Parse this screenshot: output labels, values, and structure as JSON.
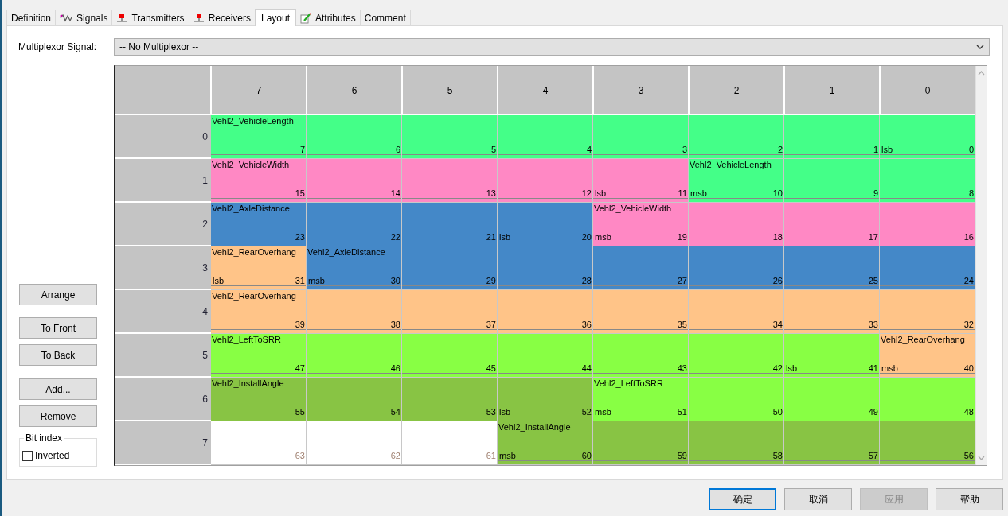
{
  "tabs": [
    {
      "label": "Definition",
      "selected": false
    },
    {
      "label": "Signals",
      "selected": false
    },
    {
      "label": "Transmitters",
      "selected": false
    },
    {
      "label": "Receivers",
      "selected": false
    },
    {
      "label": "Layout",
      "selected": true
    },
    {
      "label": "Attributes",
      "selected": false
    },
    {
      "label": "Comment",
      "selected": false
    }
  ],
  "multiplexor": {
    "label": "Multiplexor Signal:",
    "value": "-- No Multiplexor --"
  },
  "side_buttons": [
    {
      "label": "Arrange"
    },
    {
      "label": "To Front"
    },
    {
      "label": "To Back"
    },
    {
      "label": "Add..."
    },
    {
      "label": "Remove"
    }
  ],
  "bit_index": {
    "title": "Bit index",
    "label": "Inverted",
    "checked": false
  },
  "grid": {
    "columns": [
      "7",
      "6",
      "5",
      "4",
      "3",
      "2",
      "1",
      "0"
    ],
    "rows": [
      {
        "label": "0",
        "cells": [
          {
            "kind": "signal",
            "bit": "7",
            "color": "#44ff88",
            "signal": "Vehl2_VehicleLength"
          },
          {
            "kind": "signal",
            "bit": "6",
            "color": "#44ff88"
          },
          {
            "kind": "signal",
            "bit": "5",
            "color": "#44ff88"
          },
          {
            "kind": "signal",
            "bit": "4",
            "color": "#44ff88"
          },
          {
            "kind": "signal",
            "bit": "3",
            "color": "#44ff88"
          },
          {
            "kind": "signal",
            "bit": "2",
            "color": "#44ff88"
          },
          {
            "kind": "signal",
            "bit": "1",
            "color": "#44ff88"
          },
          {
            "kind": "signal",
            "bit": "0",
            "color": "#44ff88",
            "tag": "lsb"
          }
        ]
      },
      {
        "label": "1",
        "cells": [
          {
            "kind": "signal",
            "bit": "15",
            "color": "#ff88c4",
            "signal": "Vehl2_VehicleWidth"
          },
          {
            "kind": "signal",
            "bit": "14",
            "color": "#ff88c4"
          },
          {
            "kind": "signal",
            "bit": "13",
            "color": "#ff88c4"
          },
          {
            "kind": "signal",
            "bit": "12",
            "color": "#ff88c4"
          },
          {
            "kind": "signal",
            "bit": "11",
            "color": "#ff88c4",
            "tag": "lsb"
          },
          {
            "kind": "signal",
            "bit": "10",
            "color": "#44ff88",
            "signal": "Vehl2_VehicleLength",
            "tag": "msb"
          },
          {
            "kind": "signal",
            "bit": "9",
            "color": "#44ff88"
          },
          {
            "kind": "signal",
            "bit": "8",
            "color": "#44ff88"
          }
        ]
      },
      {
        "label": "2",
        "cells": [
          {
            "kind": "signal",
            "bit": "23",
            "color": "#4488c8",
            "signal": "Vehl2_AxleDistance"
          },
          {
            "kind": "signal",
            "bit": "22",
            "color": "#4488c8"
          },
          {
            "kind": "signal",
            "bit": "21",
            "color": "#4488c8"
          },
          {
            "kind": "signal",
            "bit": "20",
            "color": "#4488c8",
            "tag": "lsb"
          },
          {
            "kind": "signal",
            "bit": "19",
            "color": "#ff88c4",
            "signal": "Vehl2_VehicleWidth",
            "tag": "msb"
          },
          {
            "kind": "signal",
            "bit": "18",
            "color": "#ff88c4"
          },
          {
            "kind": "signal",
            "bit": "17",
            "color": "#ff88c4"
          },
          {
            "kind": "signal",
            "bit": "16",
            "color": "#ff88c4"
          }
        ]
      },
      {
        "label": "3",
        "cells": [
          {
            "kind": "signal",
            "bit": "31",
            "color": "#ffc488",
            "signal": "Vehl2_RearOverhang",
            "tag": "lsb"
          },
          {
            "kind": "signal",
            "bit": "30",
            "color": "#4488c8",
            "signal": "Vehl2_AxleDistance",
            "tag": "msb"
          },
          {
            "kind": "signal",
            "bit": "29",
            "color": "#4488c8"
          },
          {
            "kind": "signal",
            "bit": "28",
            "color": "#4488c8"
          },
          {
            "kind": "signal",
            "bit": "27",
            "color": "#4488c8"
          },
          {
            "kind": "signal",
            "bit": "26",
            "color": "#4488c8"
          },
          {
            "kind": "signal",
            "bit": "25",
            "color": "#4488c8"
          },
          {
            "kind": "signal",
            "bit": "24",
            "color": "#4488c8"
          }
        ]
      },
      {
        "label": "4",
        "cells": [
          {
            "kind": "signal",
            "bit": "39",
            "color": "#ffc488",
            "signal": "Vehl2_RearOverhang"
          },
          {
            "kind": "signal",
            "bit": "38",
            "color": "#ffc488"
          },
          {
            "kind": "signal",
            "bit": "37",
            "color": "#ffc488"
          },
          {
            "kind": "signal",
            "bit": "36",
            "color": "#ffc488"
          },
          {
            "kind": "signal",
            "bit": "35",
            "color": "#ffc488"
          },
          {
            "kind": "signal",
            "bit": "34",
            "color": "#ffc488"
          },
          {
            "kind": "signal",
            "bit": "33",
            "color": "#ffc488"
          },
          {
            "kind": "signal",
            "bit": "32",
            "color": "#ffc488"
          }
        ]
      },
      {
        "label": "5",
        "cells": [
          {
            "kind": "signal",
            "bit": "47",
            "color": "#88ff44",
            "signal": "Vehl2_LeftToSRR"
          },
          {
            "kind": "signal",
            "bit": "46",
            "color": "#88ff44"
          },
          {
            "kind": "signal",
            "bit": "45",
            "color": "#88ff44"
          },
          {
            "kind": "signal",
            "bit": "44",
            "color": "#88ff44"
          },
          {
            "kind": "signal",
            "bit": "43",
            "color": "#88ff44"
          },
          {
            "kind": "signal",
            "bit": "42",
            "color": "#88ff44"
          },
          {
            "kind": "signal",
            "bit": "41",
            "color": "#88ff44",
            "tag": "lsb"
          },
          {
            "kind": "signal",
            "bit": "40",
            "color": "#ffc488",
            "signal": "Vehl2_RearOverhang",
            "tag": "msb"
          }
        ]
      },
      {
        "label": "6",
        "cells": [
          {
            "kind": "signal",
            "bit": "55",
            "color": "#88c444",
            "signal": "Vehl2_InstallAngle"
          },
          {
            "kind": "signal",
            "bit": "54",
            "color": "#88c444"
          },
          {
            "kind": "signal",
            "bit": "53",
            "color": "#88c444"
          },
          {
            "kind": "signal",
            "bit": "52",
            "color": "#88c444",
            "tag": "lsb"
          },
          {
            "kind": "signal",
            "bit": "51",
            "color": "#88ff44",
            "signal": "Vehl2_LeftToSRR",
            "tag": "msb"
          },
          {
            "kind": "signal",
            "bit": "50",
            "color": "#88ff44"
          },
          {
            "kind": "signal",
            "bit": "49",
            "color": "#88ff44"
          },
          {
            "kind": "signal",
            "bit": "48",
            "color": "#88ff44"
          }
        ]
      },
      {
        "label": "7",
        "cells": [
          {
            "kind": "unused",
            "bit": "63"
          },
          {
            "kind": "unused",
            "bit": "62"
          },
          {
            "kind": "unused",
            "bit": "61"
          },
          {
            "kind": "signal",
            "bit": "60",
            "color": "#88c444",
            "signal": "Vehl2_InstallAngle",
            "tag": "msb"
          },
          {
            "kind": "signal",
            "bit": "59",
            "color": "#88c444"
          },
          {
            "kind": "signal",
            "bit": "58",
            "color": "#88c444"
          },
          {
            "kind": "signal",
            "bit": "57",
            "color": "#88c444"
          },
          {
            "kind": "signal",
            "bit": "56",
            "color": "#88c444"
          }
        ]
      }
    ]
  },
  "dialog_buttons": [
    {
      "label": "确定",
      "default": true,
      "disabled": false
    },
    {
      "label": "取消",
      "default": false,
      "disabled": false
    },
    {
      "label": "应用",
      "default": false,
      "disabled": true
    },
    {
      "label": "帮助",
      "default": false,
      "disabled": false
    }
  ]
}
